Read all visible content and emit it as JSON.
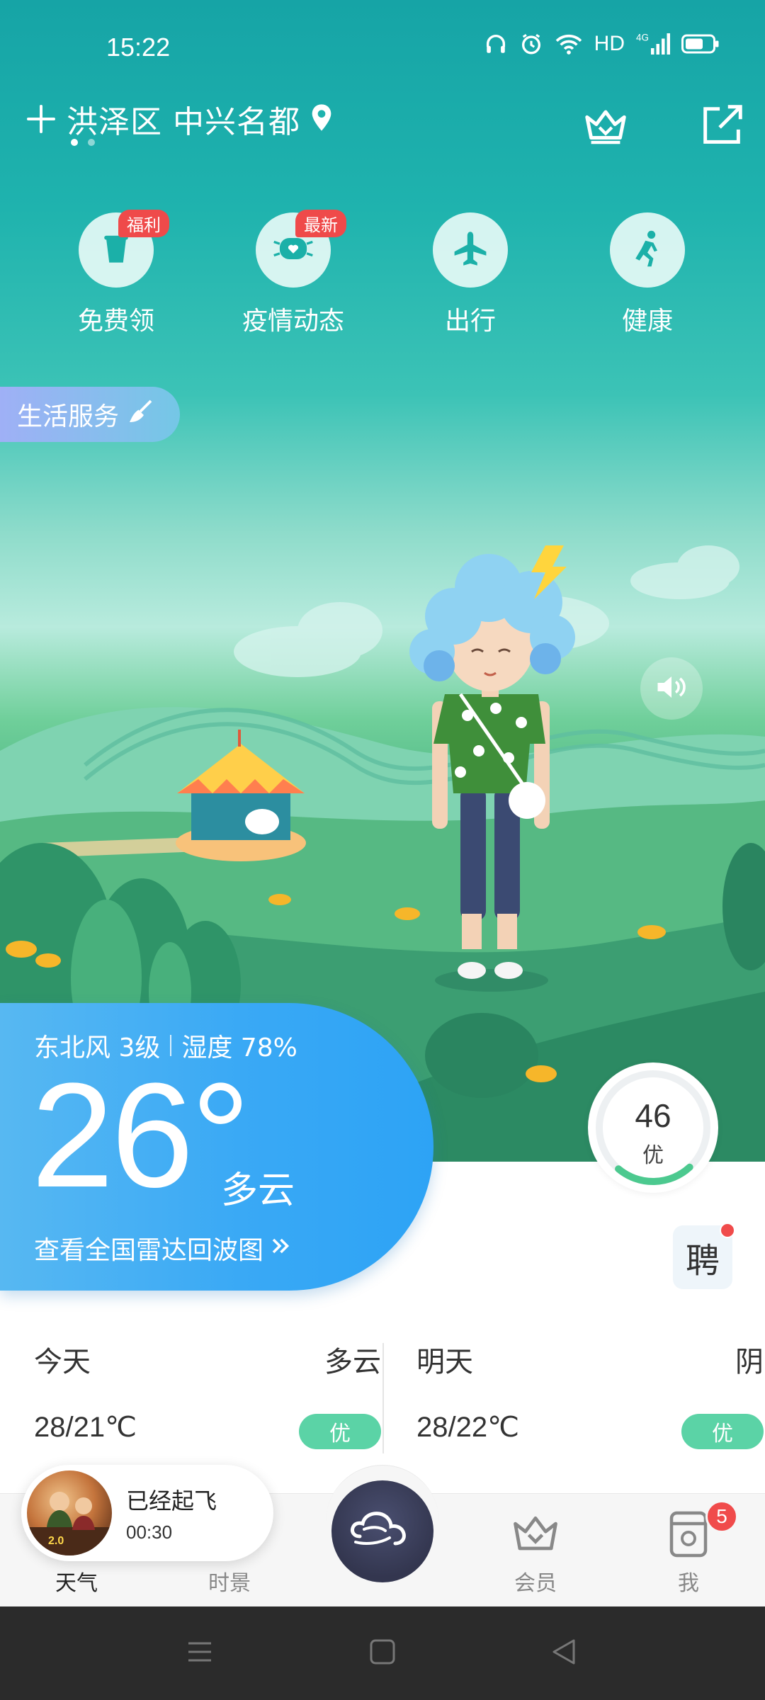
{
  "status_bar": {
    "time": "15:22",
    "network": "HD",
    "signal": "4G",
    "icons": [
      "headphones-icon",
      "alarm-icon",
      "wifi-icon",
      "signal-icon",
      "battery-icon"
    ]
  },
  "header": {
    "location": "洪泽区 中兴名都",
    "page_count": 2,
    "active_page": 1
  },
  "quick_entries": [
    {
      "label": "免费领",
      "badge": "福利",
      "icon": "cup-icon"
    },
    {
      "label": "疫情动态",
      "badge": "最新",
      "icon": "mask-icon"
    },
    {
      "label": "出行",
      "badge": "",
      "icon": "plane-icon"
    },
    {
      "label": "健康",
      "badge": "",
      "icon": "runner-icon"
    }
  ],
  "life_service": {
    "label": "生活服务"
  },
  "current": {
    "wind": "东北风 3级",
    "humidity": "湿度 78%",
    "temperature": "26°",
    "condition": "多云",
    "radar_link": "查看全国雷达回波图"
  },
  "aqi": {
    "value": "46",
    "level": "优",
    "fraction": 0.23,
    "color": "#4cc98f"
  },
  "hire": {
    "label": "聘"
  },
  "forecast": [
    {
      "day": "今天",
      "condition": "多云",
      "temp": "28/21℃",
      "aqi": "优"
    },
    {
      "day": "明天",
      "condition": "阴",
      "temp": "28/22℃",
      "aqi": "优"
    }
  ],
  "mini_player": {
    "title": "已经起飞",
    "time": "00:30"
  },
  "tabs": [
    {
      "label": "天气",
      "icon": "weather-icon",
      "active": true
    },
    {
      "label": "时景",
      "icon": "scene-icon",
      "active": false
    },
    {
      "label": "",
      "icon": "cloud-logo-icon",
      "active": false
    },
    {
      "label": "会员",
      "icon": "crown-icon",
      "active": false
    },
    {
      "label": "我",
      "icon": "profile-icon",
      "active": false,
      "badge": "5"
    }
  ],
  "colors": {
    "sky_top": "#16a4a6",
    "temp_card": "#3aa9f5",
    "aqi_good": "#5bd3a6",
    "badge_red": "#ef4a4a"
  }
}
